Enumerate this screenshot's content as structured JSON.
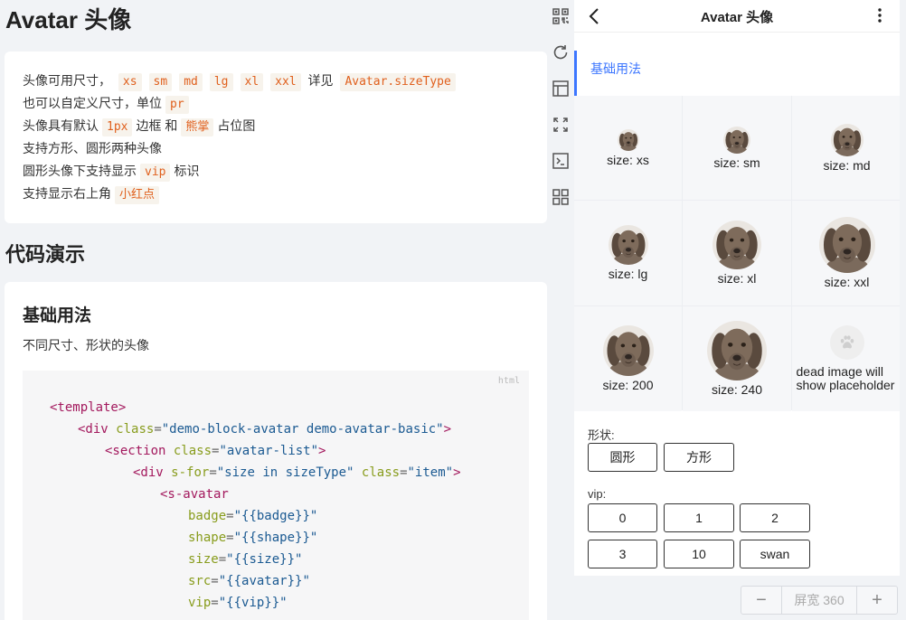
{
  "doc": {
    "title": "Avatar 头像",
    "intro": {
      "line1_text": "头像可用尺寸，",
      "line1_codes": [
        "xs",
        "sm",
        "md",
        "lg",
        "xl",
        "xxl"
      ],
      "line1_see": "详见",
      "line1_ref": "Avatar.sizeType",
      "line2_text": "也可以自定义尺寸，单位",
      "line2_code": "pr",
      "line3_text": "头像具有默认",
      "line3_code1": "1px",
      "line3_mid": "边框 和",
      "line3_code2": "熊掌",
      "line3_end": "占位图",
      "line4_text": "支持方形、圆形两种头像",
      "line5_text": "圆形头像下支持显示",
      "line5_code": "vip",
      "line5_end": "标识",
      "line6_text": "支持显示右上角",
      "line6_code": "小红点"
    },
    "demo_heading": "代码演示",
    "demo": {
      "title": "基础用法",
      "desc": "不同尺寸、形状的头像",
      "lang": "html",
      "code": {
        "l1_tag": "<template>",
        "l2_tag": "<div",
        "l2_attr": "class",
        "l2_val": "\"demo-block-avatar demo-avatar-basic\"",
        "l2_end": ">",
        "l3_tag": "<section",
        "l3_attr": "class",
        "l3_val": "\"avatar-list\"",
        "l3_end": ">",
        "l4_tag": "<div",
        "l4_attr1": "s-for",
        "l4_val1": "\"size in sizeType\"",
        "l4_attr2": "class",
        "l4_val2": "\"item\"",
        "l4_end": ">",
        "l5_tag": "<s-avatar",
        "l6_attr": "badge",
        "l6_val": "\"{{badge}}\"",
        "l7_attr": "shape",
        "l7_val": "\"{{shape}}\"",
        "l8_attr": "size",
        "l8_val": "\"{{size}}\"",
        "l9_attr": "src",
        "l9_val": "\"{{avatar}}\"",
        "l10_attr": "vip",
        "l10_val": "\"{{vip}}\""
      }
    }
  },
  "toolbar": {
    "icons": [
      "qrcode-icon",
      "refresh-icon",
      "layout-icon",
      "fullscreen-icon",
      "terminal-icon",
      "grid-icon"
    ]
  },
  "phone": {
    "nav_title": "Avatar 头像",
    "section_title": "基础用法",
    "avatars": [
      {
        "label": "size: xs"
      },
      {
        "label": "size: sm"
      },
      {
        "label": "size: md"
      },
      {
        "label": "size: lg"
      },
      {
        "label": "size: xl"
      },
      {
        "label": "size: xxl"
      },
      {
        "label": "size: 200"
      },
      {
        "label": "size: 240"
      },
      {
        "label": "dead image will show placeholder"
      }
    ],
    "shape_label": "形状:",
    "shape_options": [
      "圆形",
      "方形"
    ],
    "vip_label": "vip:",
    "vip_options": [
      "0",
      "1",
      "2",
      "3",
      "10",
      "swan"
    ]
  },
  "bottombar": {
    "minus": "−",
    "width_text": "屏宽 360",
    "plus": "+"
  },
  "colors": {
    "accent": "#3c76ff",
    "code_text": "#e0601d",
    "tag": "#a3185d",
    "attr": "#889c1c",
    "string": "#1b5a92"
  }
}
